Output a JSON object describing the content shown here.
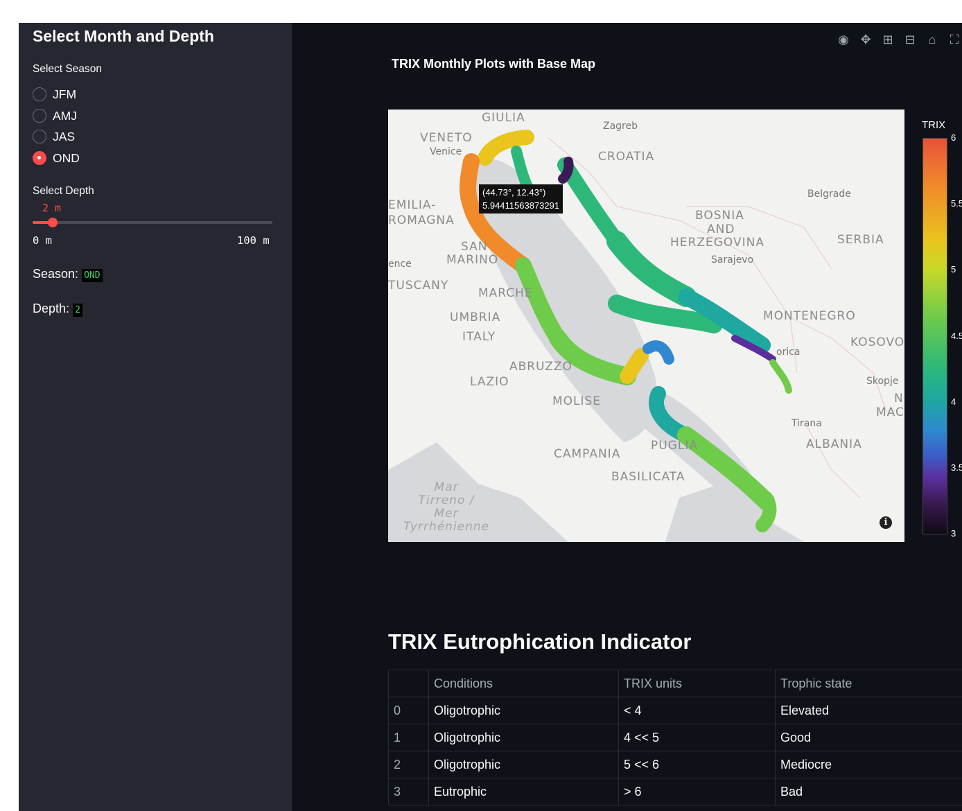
{
  "sidebar": {
    "title": "Select Month and Depth",
    "season_label": "Select Season",
    "seasons": [
      "JFM",
      "AMJ",
      "JAS",
      "OND"
    ],
    "selected_season": "OND",
    "depth_label": "Select Depth",
    "depth_value": "2 m",
    "depth_min": "0 m",
    "depth_max": "100 m",
    "depth_fraction": 0.02,
    "season_line_label": "Season:",
    "season_line_value": "OND",
    "depth_line_label": "Depth:",
    "depth_line_value": "2"
  },
  "plot": {
    "title": "TRIX Monthly Plots with Base Map",
    "toolbar_icons": [
      "camera-icon",
      "pan-icon",
      "zoom-in-icon",
      "zoom-out-icon",
      "home-icon",
      "fullscreen-icon"
    ],
    "tooltip_line1": "(44.73°, 12.43°)",
    "tooltip_line2": "5.94411563873291",
    "colorbar_title": "TRIX",
    "colorbar_ticks": [
      "6",
      "5.5",
      "5",
      "4.5",
      "4",
      "3.5",
      "3"
    ],
    "colorscale": [
      "#0f0a12",
      "#3b1a55",
      "#5b2e9e",
      "#3a5fc8",
      "#2f88d0",
      "#1ea8a0",
      "#2db87a",
      "#6fcb4a",
      "#c9d829",
      "#e9c51e",
      "#f08a2a",
      "#e8523a"
    ],
    "places": [
      "GIULIA",
      "Zagreb",
      "VENETO",
      "Venice",
      "CROATIA",
      "EMILIA-",
      "ROMAGNA",
      "Belgrade",
      "BOSNIA",
      "AND",
      "HERZEGOVINA",
      "SERBIA",
      "SAN",
      "MARINO",
      "Sarajevo",
      "ence",
      "TUSCANY",
      "MARCHE",
      "UMBRIA",
      "MONTENEGRO",
      "ITALY",
      "KOSOVO",
      "orica",
      "ABRUZZO",
      "Skopje",
      "LAZIO",
      "MOLISE",
      "N",
      "MAC",
      "Tirana",
      "ALBANIA",
      "CAMPANIA",
      "PUGLIA",
      "BASILICATA",
      "Mar\nTirreno /\nMer\nTyrrhénienne"
    ]
  },
  "table": {
    "title": "TRIX Eutrophication Indicator",
    "headers": [
      "",
      "Conditions",
      "TRIX units",
      "Trophic state"
    ],
    "rows": [
      [
        "0",
        "Oligotrophic",
        "< 4",
        "Elevated"
      ],
      [
        "1",
        "Oligotrophic",
        "4 << 5",
        "Good"
      ],
      [
        "2",
        "Oligotrophic",
        "5 << 6",
        "Mediocre"
      ],
      [
        "3",
        "Eutrophic",
        "> 6",
        "Bad"
      ]
    ]
  }
}
